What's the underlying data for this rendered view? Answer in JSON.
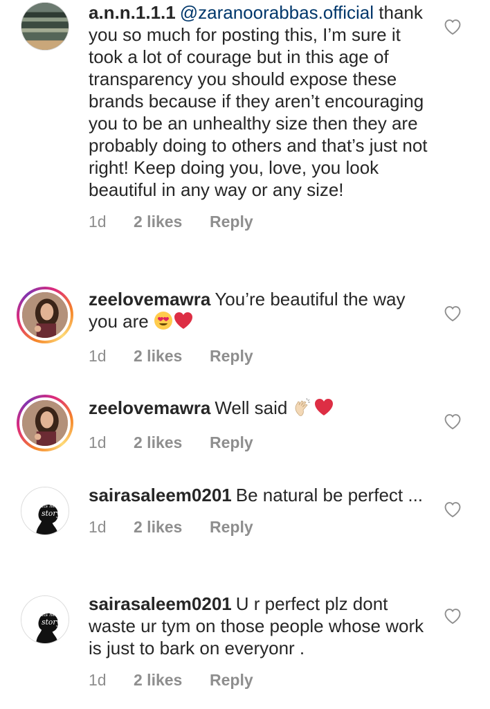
{
  "comments": [
    {
      "username": "a.n.n.1.1.1",
      "mention": "@zaranoorabbas.official",
      "text": "thank you so much for posting this, I’m sure it took a lot of courage but in this age of transparency you should expose these brands because if they aren’t encouraging you to be an unhealthy size then they are probably doing to others and that’s just not right! Keep doing you, love, you look beautiful in any way or any size!",
      "time": "1d",
      "likes": "2 likes",
      "reply": "Reply"
    },
    {
      "username": "zeelovemawra",
      "text": "You’re beautiful the way you are",
      "emojis": [
        "heart-eyes-emoji",
        "red-heart-emoji"
      ],
      "time": "1d",
      "likes": "2 likes",
      "reply": "Reply"
    },
    {
      "username": "zeelovemawra",
      "text": "Well said",
      "emojis": [
        "clapping-hands-emoji",
        "red-heart-emoji"
      ],
      "time": "1d",
      "likes": "2 likes",
      "reply": "Reply"
    },
    {
      "username": "sairasaleem0201",
      "text": "Be natural be perfect ...",
      "time": "1d",
      "likes": "2 likes",
      "reply": "Reply"
    },
    {
      "username": "sairasaleem0201",
      "text": "U r perfect plz dont waste ur tym on those people whose work is just to bark on everyonr .",
      "time": "1d",
      "likes": "2 likes",
      "reply": "Reply"
    }
  ],
  "logo_text": "Its her own story",
  "colors": {
    "text": "#262626",
    "meta": "#8e8e8e",
    "mention": "#00376b",
    "story_ring_start": "#f58529",
    "story_ring_end": "#dd2a7b"
  }
}
